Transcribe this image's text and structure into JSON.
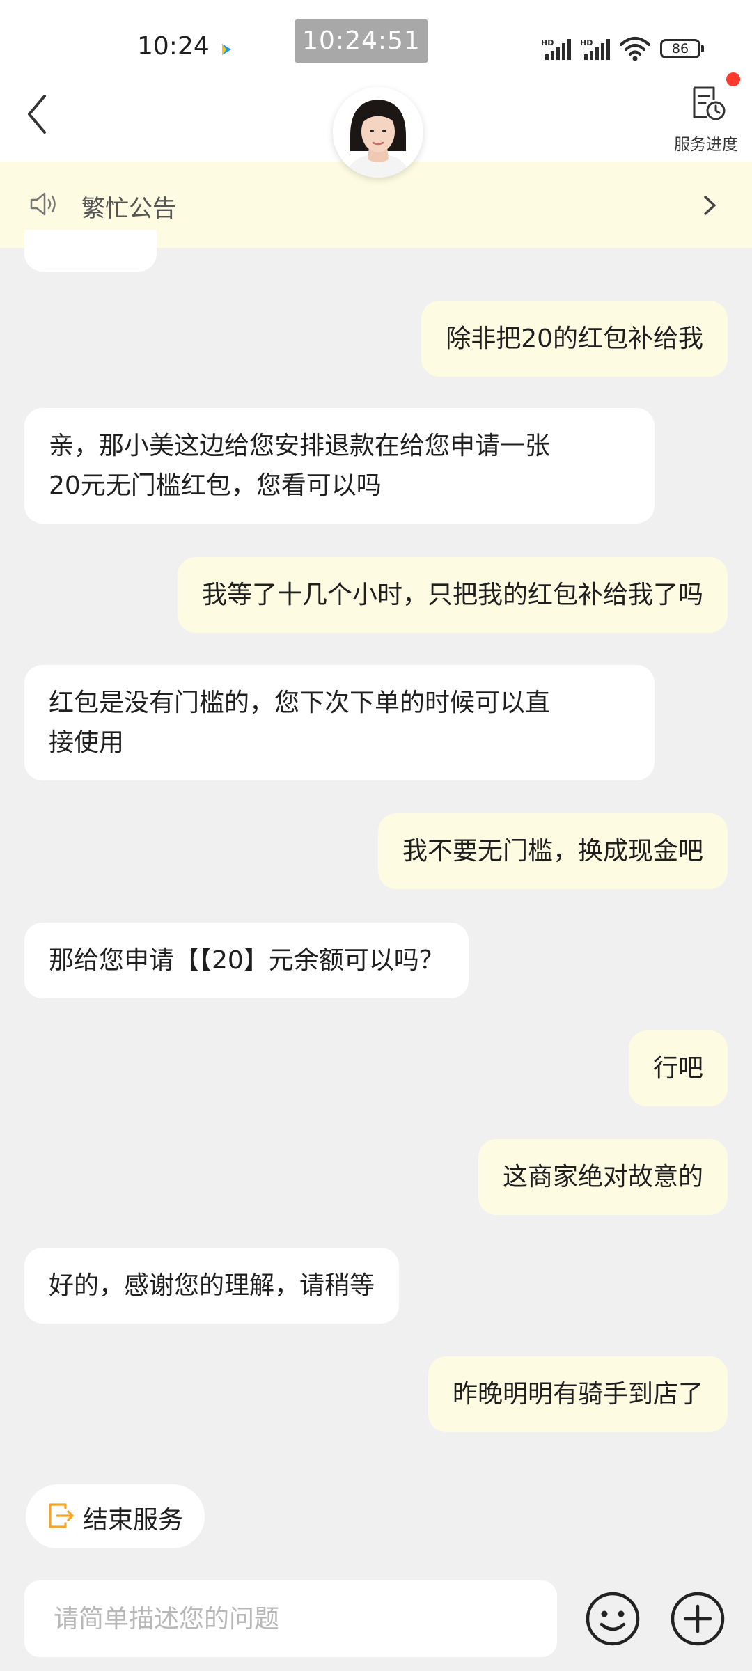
{
  "status_bar": {
    "time": "10:24",
    "clock": "10:24:51",
    "battery": "86",
    "signal_label": "HD"
  },
  "header": {
    "back_icon": "chevron-left-icon",
    "avatar": "agent-avatar",
    "service_progress_label": "服务进度",
    "service_progress_icon": "document-clock-icon"
  },
  "notice": {
    "icon": "speaker-icon",
    "text": "繁忙公告"
  },
  "messages": [
    {
      "side": "out",
      "lines": [
        "除非把20的红包补给我"
      ]
    },
    {
      "side": "in",
      "lines": [
        "亲，那小美这边给您安排退款在给您申请一张",
        "20元无门槛红包，您看可以吗"
      ]
    },
    {
      "side": "out",
      "lines": [
        "我等了十几个小时，只把我的红包补给我了吗"
      ]
    },
    {
      "side": "in",
      "lines": [
        "红包是没有门槛的，您下次下单的时候可以直",
        "接使用"
      ]
    },
    {
      "side": "out",
      "lines": [
        "我不要无门槛，换成现金吧"
      ]
    },
    {
      "side": "in",
      "lines": [
        "那给您申请【【20】元余额可以吗？"
      ]
    },
    {
      "side": "out",
      "lines": [
        "行吧"
      ]
    },
    {
      "side": "out",
      "lines": [
        "这商家绝对故意的"
      ]
    },
    {
      "side": "in",
      "lines": [
        "好的，感谢您的理解，请稍等"
      ]
    },
    {
      "side": "out",
      "lines": [
        "昨晚明明有骑手到店了"
      ]
    }
  ],
  "bottom": {
    "end_service_label": "结束服务",
    "end_service_icon": "exit-icon",
    "input_placeholder": "请简单描述您的问题",
    "emoji_icon": "emoji-icon",
    "plus_icon": "plus-icon"
  },
  "colors": {
    "background": "#f0f0f0",
    "outgoing_bubble": "#fdfbe1",
    "incoming_bubble": "#ffffff",
    "accent_orange": "#f5a524",
    "badge_red": "#ff3b30"
  }
}
